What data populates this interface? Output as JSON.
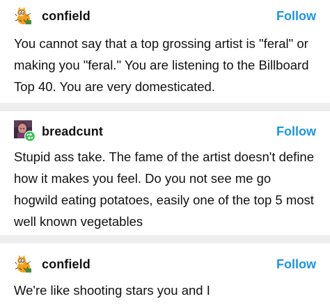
{
  "posts": [
    {
      "username": "confield",
      "follow_label": "Follow",
      "avatar_icon": "garfield-avatar-icon",
      "body": "You cannot say that a top grossing artist is \"feral\" or making you \"feral.\" You are listening to the Billboard Top 40. You are very domesticated."
    },
    {
      "username": "breadcunt",
      "follow_label": "Follow",
      "avatar_icon": "portrait-avatar-icon",
      "reblog_badge_icon": "reblog-icon",
      "body": "Stupid ass take. The fame of the artist doesn't define how it makes you feel. Do you not see me go hogwild eating potatoes, easily one of the top 5 most well known vegetables"
    },
    {
      "username": "confield",
      "follow_label": "Follow",
      "avatar_icon": "garfield-avatar-icon",
      "body": "We're like shooting stars you and I"
    }
  ],
  "colors": {
    "follow": "#1c95e6",
    "separator": "#eeeeee",
    "reblog_badge": "#36c055"
  }
}
